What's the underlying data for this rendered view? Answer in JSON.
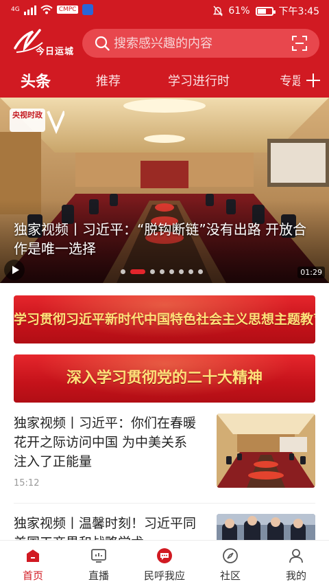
{
  "status_bar": {
    "network": "4G",
    "app_badge": "CMPC",
    "battery_percent": "61%",
    "battery_level": 0.61,
    "time": "下午3:45"
  },
  "header": {
    "logo_text": "今日运城",
    "search_placeholder": "搜索感兴趣的内容",
    "tabs": [
      {
        "label": "头条",
        "active": true
      },
      {
        "label": "推荐",
        "active": false
      },
      {
        "label": "学习进行时",
        "active": false
      },
      {
        "label": "专题",
        "active": false
      }
    ],
    "icons": {
      "search": "search-icon",
      "scan": "scan-icon",
      "add_channel": "plus-icon"
    }
  },
  "banner": {
    "badge": "央视时政",
    "caption": "独家视频丨习近平：“脱钩断链”没有出路 开放合作是唯一选择",
    "duration": "01:29",
    "slide_count": 8,
    "active_slide": 1
  },
  "promos": [
    {
      "text": "学习贯彻习近平新时代中国特色社会主义思想主题教育"
    },
    {
      "text": "深入学习贯彻党的二十大精神"
    }
  ],
  "news": [
    {
      "title": "独家视频丨习近平：你们在春暖花开之际访问中国 为中美关系注入了正能量",
      "time": "15:12"
    },
    {
      "title": "独家视频丨温馨时刻！习近平同美国工商界和战略学术"
    }
  ],
  "bottom_nav": [
    {
      "label": "首页",
      "icon": "home-icon",
      "active": true
    },
    {
      "label": "直播",
      "icon": "tv-icon",
      "active": false
    },
    {
      "label": "民呼我应",
      "icon": "chat-bubble-icon",
      "active": false
    },
    {
      "label": "社区",
      "icon": "compass-icon",
      "active": false
    },
    {
      "label": "我的",
      "icon": "user-icon",
      "active": false
    }
  ],
  "colors": {
    "brand_red": "#d11a22",
    "promo_text": "#ffe27a",
    "time_gray": "#999999"
  }
}
